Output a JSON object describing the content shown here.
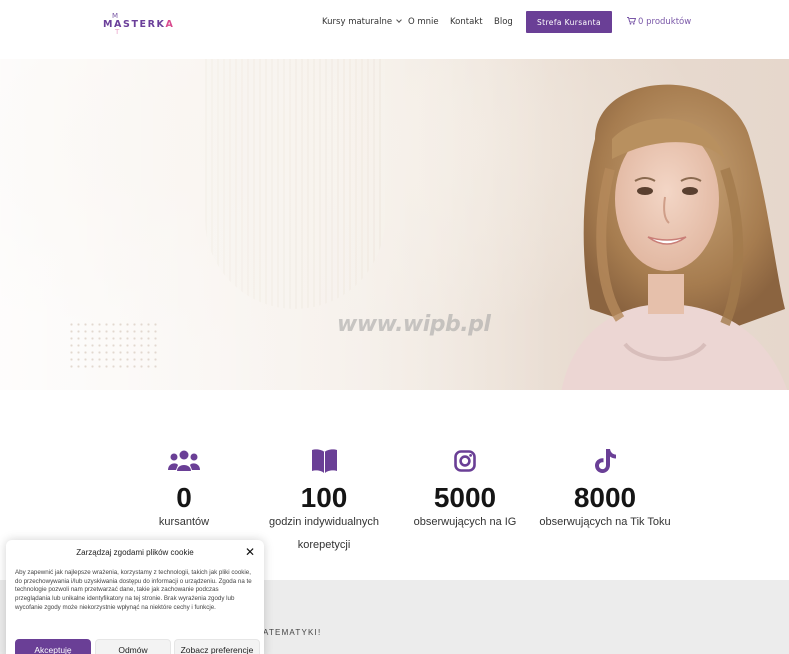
{
  "header": {
    "logo": {
      "top_letter": "M",
      "word": "MASTERKA",
      "bottom_letter": "T"
    },
    "nav": [
      {
        "label": "Kursy maturalne",
        "has_dropdown": true
      },
      {
        "label": "O mnie"
      },
      {
        "label": "Kontakt"
      },
      {
        "label": "Blog"
      }
    ],
    "cta_label": "Strefa Kursanta",
    "cart_label": "0 produktów",
    "accent_color": "#6a3f96"
  },
  "hero": {
    "watermark": "www.wipb.pl"
  },
  "stats": [
    {
      "icon": "users-icon",
      "number": "0",
      "label": "kursantów"
    },
    {
      "icon": "book-icon",
      "number": "100",
      "label": "godzin indywidualnych korepetycji"
    },
    {
      "icon": "instagram-icon",
      "number": "5000",
      "label": "obserwujących na IG"
    },
    {
      "icon": "tiktok-icon",
      "number": "8000",
      "label": "obserwujących na Tik Toku"
    }
  ],
  "band": {
    "text_fragment": "ATEMATYKI!"
  },
  "cookie": {
    "title": "Zarządzaj zgodami plików cookie",
    "body": "Aby zapewnić jak najlepsze wrażenia, korzystamy z technologii, takich jak pliki cookie, do przechowywania i/lub uzyskiwania dostępu do informacji o urządzeniu. Zgoda na te technologie pozwoli nam przetwarzać dane, takie jak zachowanie podczas przeglądania lub unikalne identyfikatory na tej stronie. Brak wyrażenia zgody lub wycofanie zgody może niekorzystnie wpłynąć na niektóre cechy i funkcje.",
    "accept_label": "Akceptuję",
    "deny_label": "Odmów",
    "prefs_label": "Zobacz preferencje",
    "close_icon": "close-icon"
  }
}
